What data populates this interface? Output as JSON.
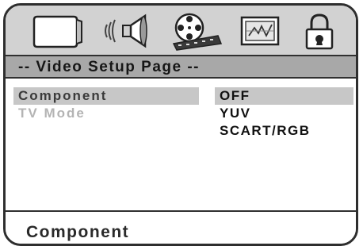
{
  "icons": [
    {
      "name": "tv-screen-icon",
      "selected": false
    },
    {
      "name": "speaker-audio-icon",
      "selected": false
    },
    {
      "name": "film-reel-video-icon",
      "selected": true
    },
    {
      "name": "preference-panel-icon",
      "selected": false
    },
    {
      "name": "padlock-icon",
      "selected": false
    }
  ],
  "page_title": "-- Video Setup Page --",
  "menu": {
    "items": [
      {
        "label": "Component",
        "selected": true
      },
      {
        "label": "TV Mode",
        "selected": false
      }
    ]
  },
  "options": [
    {
      "label": "OFF",
      "selected": true
    },
    {
      "label": "YUV",
      "selected": false
    },
    {
      "label": "SCART/RGB",
      "selected": false
    }
  ],
  "status": "Component",
  "colors": {
    "iconbar_bg": "#d2d2d2",
    "titlebar_bg": "#a8a8a8",
    "highlight": "#c7c7c7",
    "border": "#2e2e2e",
    "dim_text": "#b4b4b4"
  }
}
